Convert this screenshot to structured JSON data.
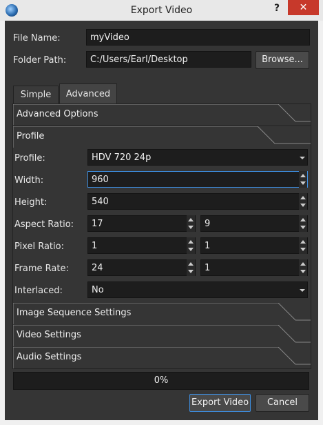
{
  "window": {
    "title": "Export Video",
    "help": "?",
    "close": "✕"
  },
  "file": {
    "name_label": "File Name:",
    "name_value": "myVideo",
    "folder_label": "Folder Path:",
    "folder_value": "C:/Users/Earl/Desktop",
    "browse": "Browse..."
  },
  "tabs": [
    {
      "label": "Simple",
      "active": false
    },
    {
      "label": "Advanced",
      "active": true
    }
  ],
  "sections": {
    "advanced": "Advanced Options",
    "profile": "Profile",
    "image_sequence": "Image Sequence Settings",
    "video": "Video Settings",
    "audio": "Audio Settings"
  },
  "profile": {
    "profile_label": "Profile:",
    "profile_value": "HDV 720 24p",
    "width_label": "Width:",
    "width_value": "960",
    "height_label": "Height:",
    "height_value": "540",
    "aspect_label": "Aspect Ratio:",
    "aspect_num": "17",
    "aspect_den": "9",
    "pixel_label": "Pixel Ratio:",
    "pixel_num": "1",
    "pixel_den": "1",
    "fps_label": "Frame Rate:",
    "fps_num": "24",
    "fps_den": "1",
    "interlaced_label": "Interlaced:",
    "interlaced_value": "No"
  },
  "progress": {
    "text": "0%",
    "value": 0
  },
  "buttons": {
    "export": "Export Video",
    "cancel": "Cancel"
  },
  "colors": {
    "accent": "#3d8ee0",
    "close": "#c7392b",
    "panel": "#353535"
  }
}
